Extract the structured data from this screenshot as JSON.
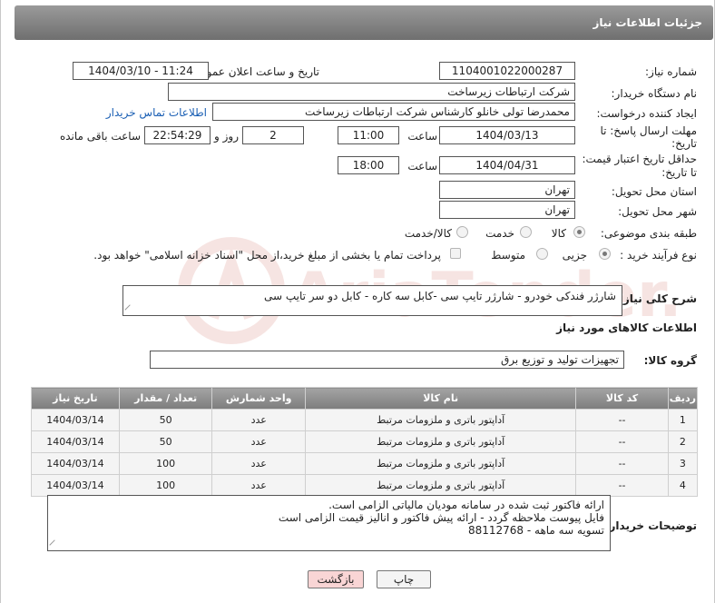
{
  "header": {
    "title": "جزئیات اطلاعات نیاز"
  },
  "fields": {
    "need_number_label": "شماره نیاز:",
    "need_number": "1104001022000287",
    "announce_label": "تاریخ و ساعت اعلان عمومی:",
    "announce_value": "1404/03/10 - 11:24",
    "buyer_org_label": "نام دستگاه خریدار:",
    "buyer_org": "شرکت ارتباطات زیرساخت",
    "requester_label": "ایجاد کننده درخواست:",
    "requester": "محمدرضا تولی خانلو کارشناس شرکت ارتباطات زیرساخت",
    "contact_link": "اطلاعات تماس خریدار",
    "deadline_label_1": "مهلت ارسال پاسخ: تا",
    "deadline_label_2": "تاریخ:",
    "deadline_date": "1404/03/13",
    "time_label": "ساعت",
    "deadline_time": "11:00",
    "days_value": "2",
    "days_label": "روز و",
    "remaining_time": "22:54:29",
    "remaining_label": "ساعت باقی مانده",
    "validity_label_1": "حداقل تاریخ اعتبار قیمت:",
    "validity_label_2": "تا تاریخ:",
    "validity_date": "1404/04/31",
    "validity_time": "18:00",
    "province_label": "استان محل تحویل:",
    "province": "تهران",
    "city_label": "شهر محل تحویل:",
    "city": "تهران",
    "category_label": "طبقه بندی موضوعی:",
    "category_options": [
      "کالا",
      "خدمت",
      "کالا/خدمت"
    ],
    "process_label": "نوع فرآیند خرید :",
    "process_options": [
      "جزیی",
      "متوسط"
    ],
    "payment_note": "پرداخت تمام یا بخشی از مبلغ خرید،از محل \"اسناد خزانه اسلامی\" خواهد بود.",
    "description_label": "شرح کلی نیاز:",
    "description": "شارژر فندکی خودرو - شارژر تایپ سی -کابل سه کاره - کابل دو سر تایپ سی",
    "goods_info_title": "اطلاعات کالاهای مورد نیاز",
    "goods_group_label": "گروه کالا:",
    "goods_group": "تجهیزات تولید و توزیع برق"
  },
  "table": {
    "headers": [
      "ردیف",
      "کد کالا",
      "نام کالا",
      "واحد شمارش",
      "تعداد / مقدار",
      "تاریخ نیاز"
    ],
    "rows": [
      [
        "1",
        "--",
        "آداپتور باتری و ملزومات مرتبط",
        "عدد",
        "50",
        "1404/03/14"
      ],
      [
        "2",
        "--",
        "آداپتور باتری و ملزومات مرتبط",
        "عدد",
        "50",
        "1404/03/14"
      ],
      [
        "3",
        "--",
        "آداپتور باتری و ملزومات مرتبط",
        "عدد",
        "100",
        "1404/03/14"
      ],
      [
        "4",
        "--",
        "آداپتور باتری و ملزومات مرتبط",
        "عدد",
        "100",
        "1404/03/14"
      ]
    ]
  },
  "buyer_notes": {
    "label": "توضیحات خریدار:",
    "lines": [
      "ارائه فاکتور ثبت شده در سامانه مودیان مالیاتی الزامی است.",
      "فایل پیوست ملاحظه گردد - ارائه پیش فاکتور و انالیز قیمت الزامی است",
      "تسویه سه ماهه - 88112768"
    ]
  },
  "buttons": {
    "print": "چاپ",
    "back": "بازگشت"
  },
  "watermark_text": "AriaTender.net",
  "colors": {
    "header_bg": "#7f7f7f",
    "link": "#1a5fb4",
    "back_btn_bg": "#f9d5d5",
    "watermark": "#c0392b"
  }
}
